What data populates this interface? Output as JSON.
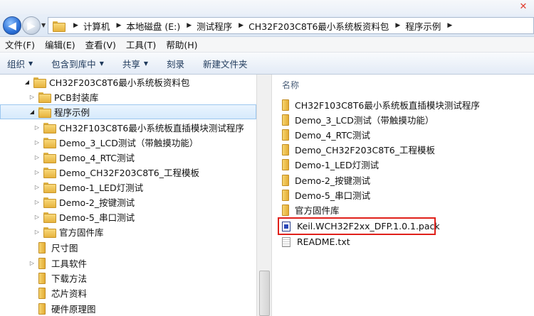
{
  "address_bar": {
    "crumbs": [
      "计算机",
      "本地磁盘 (E:)",
      "测试程序",
      "CH32F203C8T6最小系统板资料包",
      "程序示例"
    ]
  },
  "menu": [
    "文件(F)",
    "编辑(E)",
    "查看(V)",
    "工具(T)",
    "帮助(H)"
  ],
  "toolbar": {
    "organize": "组织",
    "include_in_library": "包含到库中",
    "share": "共享",
    "burn": "刻录",
    "new_folder": "新建文件夹"
  },
  "tree": [
    {
      "label": "CH32F203C8T6最小系统板资料包",
      "state": "expanded"
    },
    {
      "label": "PCB封装库",
      "state": "collapsed"
    },
    {
      "label": "程序示例",
      "state": "expanded",
      "selected": true
    },
    {
      "label": "CH32F103C8T6最小系统板直插模块测试程序",
      "state": "collapsed"
    },
    {
      "label": "Demo_3_LCD测试（带触摸功能）",
      "state": "collapsed"
    },
    {
      "label": "Demo_4_RTC测试",
      "state": "collapsed"
    },
    {
      "label": "Demo_CH32F203C8T6_工程模板",
      "state": "collapsed"
    },
    {
      "label": "Demo-1_LED灯测试",
      "state": "collapsed"
    },
    {
      "label": "Demo-2_按键测试",
      "state": "collapsed"
    },
    {
      "label": "Demo-5_串口测试",
      "state": "collapsed"
    },
    {
      "label": "官方固件库",
      "state": "collapsed"
    },
    {
      "label": "尺寸图",
      "state": "none"
    },
    {
      "label": "工具软件",
      "state": "collapsed"
    },
    {
      "label": "下载方法",
      "state": "none"
    },
    {
      "label": "芯片资料",
      "state": "none"
    },
    {
      "label": "硬件原理图",
      "state": "none"
    }
  ],
  "file_list": {
    "column_name": "名称",
    "items": [
      {
        "name": "CH32F103C8T6最小系统板直插模块测试程序",
        "type": "folder"
      },
      {
        "name": "Demo_3_LCD测试（带触摸功能）",
        "type": "folder"
      },
      {
        "name": "Demo_4_RTC测试",
        "type": "folder"
      },
      {
        "name": "Demo_CH32F203C8T6_工程模板",
        "type": "folder"
      },
      {
        "name": "Demo-1_LED灯测试",
        "type": "folder"
      },
      {
        "name": "Demo-2_按键测试",
        "type": "folder"
      },
      {
        "name": "Demo-5_串口测试",
        "type": "folder"
      },
      {
        "name": "官方固件库",
        "type": "folder"
      },
      {
        "name": "Keil.WCH32F2xx_DFP.1.0.1.pack",
        "type": "pack",
        "highlighted": true
      },
      {
        "name": "README.txt",
        "type": "text"
      }
    ]
  },
  "colors": {
    "highlight_border": "#e0201a",
    "selection_bg": "#d7eafc"
  }
}
